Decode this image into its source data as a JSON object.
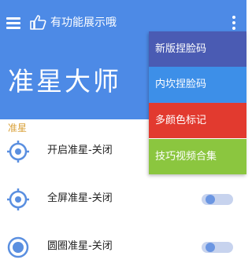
{
  "app": {
    "header_title": "有功能展示哦",
    "big_title": "准星大师",
    "accent_color": "#4d8ae6",
    "section_color": "#d9a038"
  },
  "icons": {
    "menu": "hamburger-icon",
    "thumb": "thumbs-up-icon",
    "more": "more-vertical-icon"
  },
  "popup_menu": {
    "items": [
      {
        "label": "新版捏脸码",
        "color": "#4a5bb3"
      },
      {
        "label": "内坎捏脸码",
        "color": "#3d8fe8"
      },
      {
        "label": "多颜色标记",
        "color": "#e23a2f"
      },
      {
        "label": "技巧视频合集",
        "color": "#8bc63f"
      }
    ]
  },
  "section": {
    "label": "准星",
    "items": [
      {
        "label": "开启准星-关闭",
        "icon": "crosshair-icon"
      },
      {
        "label": "全屏准星-关闭",
        "icon": "crosshair-icon",
        "toggle": "off"
      },
      {
        "label": "圆圈准星-关闭",
        "icon": "circle-target-icon",
        "toggle": "off"
      }
    ]
  }
}
